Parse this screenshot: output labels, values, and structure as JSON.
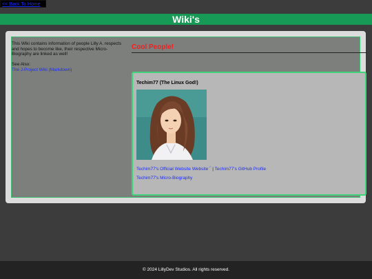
{
  "nav": {
    "back_label": "<< Back To Home"
  },
  "header": {
    "title": "Wiki's"
  },
  "sidebar": {
    "intro": "This Wiki contains information of people Lilly A. respects and hopes to become like, their respective Micro-Biography are linked as well!",
    "see_also_label": "See Also:",
    "see_also_link": "The J-Project Wiki (Markdown)"
  },
  "main": {
    "section_title": "Cool People!",
    "card": {
      "name": "Techim77 (The Linux God!)",
      "link_website": "Techim77's Official Website Website",
      "link_separator": " | ",
      "link_github": "Techim77's GitHub Profile",
      "link_bio": "Techim77's Micro-Biography"
    }
  },
  "footer": {
    "copyright": "© 2024 LillyDev Studios. All rights reserved."
  },
  "colors": {
    "background": "#3c3c3c",
    "banner": "#179a55",
    "accent_border": "#3fd37a",
    "title_red": "#ff1a1a",
    "link_blue": "#1a2bff"
  }
}
